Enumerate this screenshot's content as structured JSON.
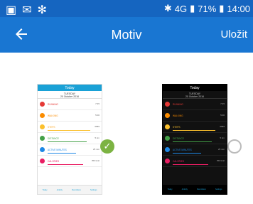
{
  "statusbar": {
    "battery": "71%",
    "time": "14:00",
    "signal": "4G"
  },
  "appbar": {
    "title": "Motiv",
    "save": "Uložit"
  },
  "preview_light": {
    "title": "Today",
    "day": "TUESDAY",
    "date": "20 October 2016",
    "rows": [
      {
        "label": "RUNNING",
        "value": "7:45"
      },
      {
        "label": "WALKING",
        "value": "5:00"
      },
      {
        "label": "STEPS",
        "value": "6589"
      },
      {
        "label": "DISTANCE",
        "value": "5 km"
      },
      {
        "label": "ACTIVE MINUTES",
        "value": "25 min"
      },
      {
        "label": "CALORIES",
        "value": "350 kcal"
      }
    ],
    "tabs": [
      "Today",
      "Activity",
      "Reminders",
      "Settings"
    ]
  },
  "preview_dark": {
    "title": "Today",
    "day": "TUESDAY",
    "date": "20 October 2016",
    "rows": [
      {
        "label": "RUNNING",
        "value": "7:45"
      },
      {
        "label": "WALKING",
        "value": "5:00"
      },
      {
        "label": "STEPS",
        "value": "6589"
      },
      {
        "label": "DISTANCE",
        "value": "5 km"
      },
      {
        "label": "ACTIVE MINUTES",
        "value": "25 min"
      },
      {
        "label": "CALORIES",
        "value": "350 kcal"
      }
    ],
    "tabs": [
      "Today",
      "Activity",
      "Reminders",
      "Settings"
    ]
  },
  "colors": {
    "statusbar": "#1565c0",
    "appbar": "#1976d2",
    "selected": "#7cb342"
  }
}
